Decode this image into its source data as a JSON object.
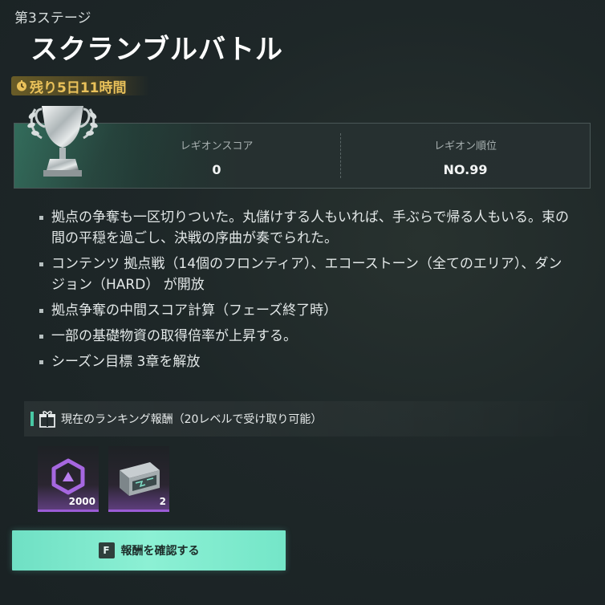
{
  "stage": {
    "label": "第3ステージ",
    "title": "スクランブルバトル",
    "time_remaining": "残り5日11時間"
  },
  "score_panel": {
    "legion_score_label": "レギオンスコア",
    "legion_score_value": "0",
    "legion_rank_label": "レギオン順位",
    "legion_rank_value": "NO.99"
  },
  "details": [
    "拠点の争奪も一区切りついた。丸儲けする人もいれば、手ぶらで帰る人もいる。束の間の平穏を過ごし、決戦の序曲が奏でられた。",
    "コンテンツ 拠点戦（14個のフロンティア）、エコーストーン（全てのエリア）、ダンジョン（HARD） が開放",
    "拠点争奪の中間スコア計算（フェーズ終了時）",
    "一部の基礎物資の取得倍率が上昇する。",
    "シーズン目標 3章を解放"
  ],
  "rewards": {
    "header": "現在のランキング報酬（20レベルで受け取り可能）",
    "items": [
      {
        "icon": "hexagon-currency-icon",
        "count": "2000"
      },
      {
        "icon": "supply-chest-icon",
        "count": "2"
      }
    ]
  },
  "confirm": {
    "key": "F",
    "label": "報酬を確認する"
  },
  "colors": {
    "accent": "#6fe0c4",
    "time_text": "#e9c15a",
    "rarity_epic": "#9b5cd6"
  }
}
